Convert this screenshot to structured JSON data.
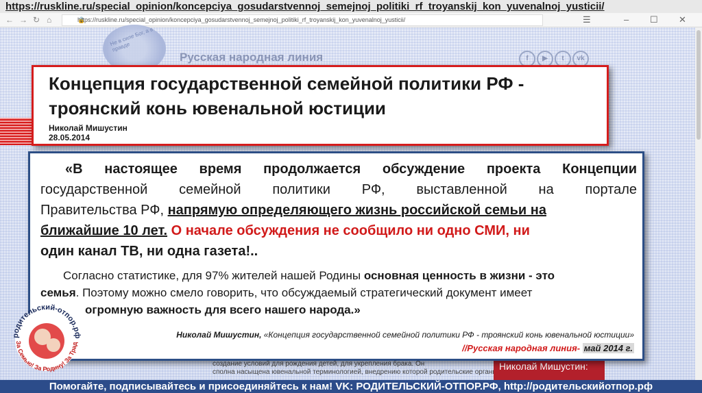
{
  "top_url": "https://ruskline.ru/special_opinion/koncepciya_gosudarstvennoj_semejnoj_politiki_rf_troyanskij_kon_yuvenalnoj_yusticii/",
  "browser": {
    "address": "https://ruskline.ru/special_opinion/koncepciya_gosudarstvennoj_semejnoj_politiki_rf_troyanskij_kon_yuvenalnoj_yusticii/"
  },
  "site": {
    "name": "Русская народная линия",
    "emblem_text": "Не в силе Бог, а в правде"
  },
  "social_icons": [
    "facebook-icon",
    "youtube-icon",
    "twitter-icon",
    "vk-icon"
  ],
  "social_labels": [
    "f",
    "▶",
    "t",
    "vk"
  ],
  "article": {
    "title_line1": "Концепция государственной семейной политики РФ -",
    "title_line2": "троянский конь ювенальной юстиции",
    "author": "Николай Мишустин",
    "date": "28.05.2014"
  },
  "quote": {
    "l1": "«В настоящее время продолжается обсуждение  проекта  Концепции",
    "l2": "государственной семейной политики РФ, выставленной на портале",
    "l3_a": "Правительства РФ,  ",
    "l3_b": "напрямую определяющего жизнь российской семьи на",
    "l4_a": "ближайшие 10 лет.",
    "l4_b": " О начале обсуждения не сообщило ни одно СМИ, ни",
    "l5": "один канал ТВ, ни одна газета!..",
    "p2_l1_a": "Согласно статистике, для 97% жителей нашей Родины ",
    "p2_l1_b": "основная ценность в жизни - это",
    "p2_l2_a": "семья",
    "p2_l2_b": ". Поэтому можно смело говорить, что обсуждаемый стратегический документ имеет",
    "p2_l3": "огромную важность для всего нашего народа.»",
    "cite_author": "Николай Мишустин,",
    "cite_title": " «Концепция государственной семейной политики РФ - троянский конь ювенальной юстиции»",
    "source": "//Русская народная линия-",
    "source_date": "май 2014 г."
  },
  "background_text": {
    "line1": "создание условий для рождения детей, для укрепления брака. Он",
    "line2": "сполна насыщена ювенальной терминологией, внедрению которой родительские организации сопротивляются",
    "name_box": "Николай Мишустин:"
  },
  "logo": {
    "top_text": "родительский-отпор.рф",
    "bottom_text": "За Семью! За Родину! За Традиции!"
  },
  "footer": {
    "text": "Помогайте, подписывайтесь и присоединяйтесь к нам! VK: РОДИТЕЛЬСКИЙ-ОТПОР.РФ, http://родительскийотпор.рф"
  },
  "colors": {
    "title_border": "#d51c1c",
    "quote_border": "#2d4f86",
    "accent_red": "#d11a1a",
    "footer_bg": "#2c4c8a"
  }
}
